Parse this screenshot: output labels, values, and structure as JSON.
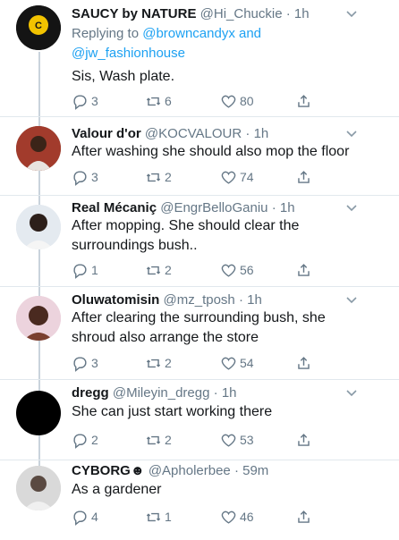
{
  "tweets": [
    {
      "name": "SAUCY by NATURE",
      "handle": "@Hi_Chuckie",
      "time": "1h",
      "replying_prefix": "Replying to",
      "replying_to": [
        "@browncandyx",
        "@jw_fashionhouse"
      ],
      "replying_joiner": "and",
      "text": "Sis, Wash plate.",
      "replies": "3",
      "retweets": "6",
      "likes": "80"
    },
    {
      "name": "Valour d'or",
      "handle": "@KOCVALOUR",
      "time": "1h",
      "text": "After washing she should also mop the floor",
      "replies": "3",
      "retweets": "2",
      "likes": "74"
    },
    {
      "name": "Real Mécaniç",
      "handle": "@EngrBelloGaniu",
      "time": "1h",
      "text_lines": [
        "After mopping. She should clear the",
        "surroundings bush.."
      ],
      "replies": "1",
      "retweets": "2",
      "likes": "56"
    },
    {
      "name": "Oluwatomisin",
      "handle": "@mz_tposh",
      "time": "1h",
      "text_lines": [
        "After clearing the surrounding bush, she",
        "shroud also arrange the store"
      ],
      "replies": "3",
      "retweets": "2",
      "likes": "54"
    },
    {
      "name": "dregg",
      "handle": "@Mileyin_dregg",
      "time": "1h",
      "text": "She can just start working there",
      "replies": "2",
      "retweets": "2",
      "likes": "53"
    },
    {
      "name": "CYBORG",
      "name_emoji": "☻",
      "handle": "@Apholerbee",
      "time": "59m",
      "text": "As a gardener",
      "replies": "4",
      "retweets": "1",
      "likes": "46"
    }
  ],
  "separator": "·",
  "colors": {
    "link": "#1da1f2",
    "secondary": "#657786",
    "thread": "#c9d3dc"
  }
}
